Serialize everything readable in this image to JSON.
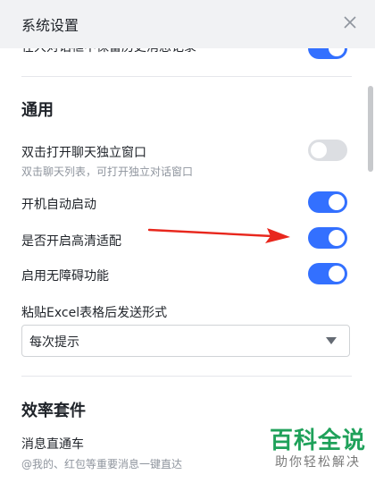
{
  "window": {
    "title": "系统设置"
  },
  "partial_row": {
    "label": "在大对话框中保留历史消息记录",
    "toggle_on": true
  },
  "general": {
    "title": "通用",
    "rows": [
      {
        "label": "双击打开聊天独立窗口",
        "desc": "双击聊天列表，可打开独立对话窗口",
        "toggle_on": false
      },
      {
        "label": "开机自动启动",
        "toggle_on": true
      },
      {
        "label": "是否开启高清适配",
        "toggle_on": true
      },
      {
        "label": "启用无障碍功能",
        "toggle_on": true
      }
    ],
    "paste_setting": {
      "label": "粘贴Excel表格后发送形式",
      "selected": "每次提示"
    }
  },
  "efficiency": {
    "title": "效率套件",
    "row": {
      "label": "消息直通车",
      "desc": "@我的、红包等重要消息一键直达"
    }
  },
  "annotation": {
    "color": "#e8271d"
  },
  "watermark": {
    "main": "百科全说",
    "sub": "助你轻松解决"
  },
  "colors": {
    "accent": "#3370ff",
    "toggle_off": "#dcdee2",
    "header_bg": "#f1f2f4"
  }
}
